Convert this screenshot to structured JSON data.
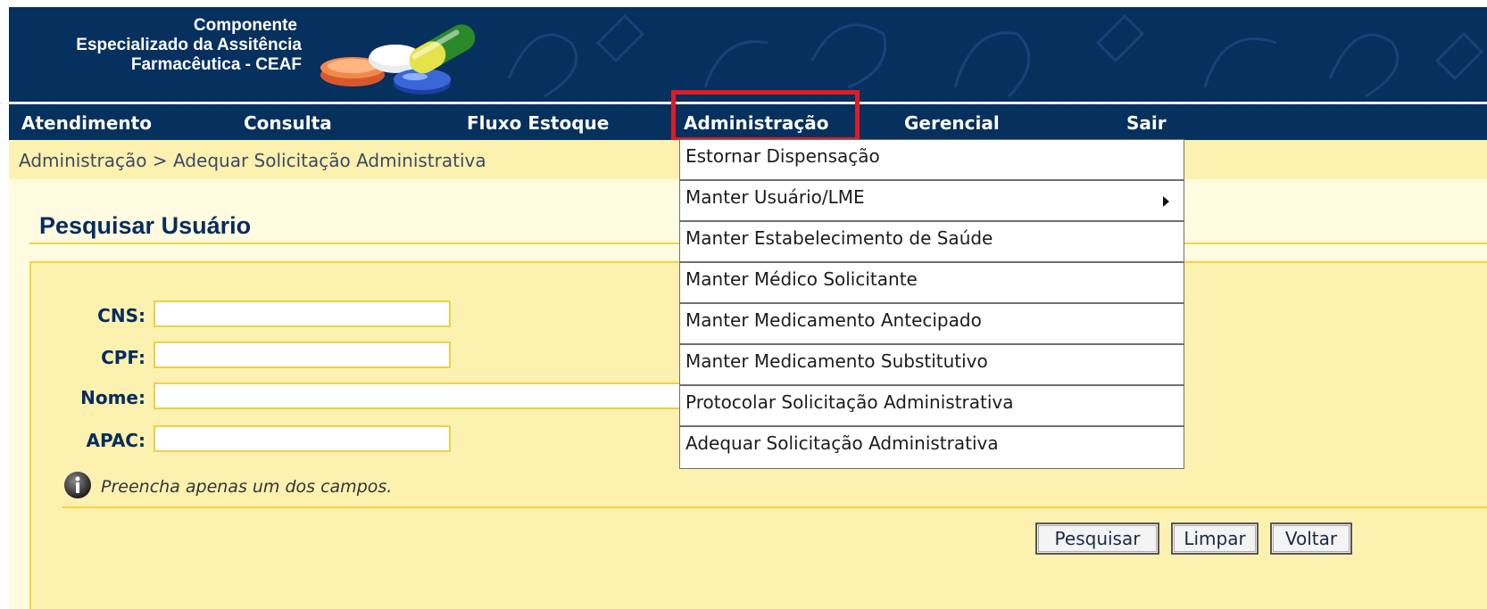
{
  "header": {
    "logo_lines": [
      "Componente",
      "Especializado da Assitência",
      "Farmacêutica - CEAF"
    ]
  },
  "nav": {
    "items": [
      {
        "label": "Atendimento"
      },
      {
        "label": "Consulta"
      },
      {
        "label": "Fluxo Estoque"
      },
      {
        "label": "Administração",
        "highlighted": true
      },
      {
        "label": "Gerencial"
      },
      {
        "label": "Sair"
      }
    ]
  },
  "breadcrumb": "Administração > Adequar Solicitação Administrativa",
  "page": {
    "title": "Pesquisar Usuário",
    "fields": [
      {
        "label": "CNS:",
        "value": ""
      },
      {
        "label": "CPF:",
        "value": ""
      },
      {
        "label": "Nome:",
        "value": ""
      },
      {
        "label": "APAC:",
        "value": ""
      }
    ],
    "hint": "Preencha apenas um dos campos.",
    "buttons": {
      "search": "Pesquisar",
      "clear": "Limpar",
      "back": "Voltar"
    }
  },
  "menu": {
    "items": [
      {
        "label": "Estornar Dispensação"
      },
      {
        "label": "Manter Usuário/LME",
        "submenu": true
      },
      {
        "label": "Manter Estabelecimento de Saúde"
      },
      {
        "label": "Manter Médico Solicitante"
      },
      {
        "label": "Manter Medicamento Antecipado"
      },
      {
        "label": "Manter Medicamento Substitutivo"
      },
      {
        "label": "Protocolar Solicitação Administrativa"
      },
      {
        "label": "Adequar Solicitação Administrativa"
      }
    ]
  },
  "colors": {
    "header_bg": "#06305e",
    "highlight_border": "#e01b22",
    "panel_bg": "#fdf1b0",
    "title_text": "#062c5d"
  }
}
